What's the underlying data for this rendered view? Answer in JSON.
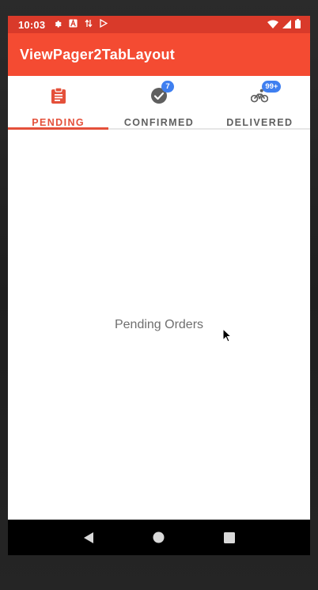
{
  "status_bar": {
    "time": "10:03",
    "bg_color": "#d93a2a"
  },
  "app_bar": {
    "title": "ViewPager2TabLayout",
    "bg_color": "#f44b32"
  },
  "tabs": [
    {
      "label": "PENDING",
      "icon": "clipboard-icon",
      "badge": "",
      "active": true
    },
    {
      "label": "CONFIRMED",
      "icon": "check-circle-icon",
      "badge": "7",
      "active": false
    },
    {
      "label": "DELIVERED",
      "icon": "bicycle-rider-icon",
      "badge": "99+",
      "active": false
    }
  ],
  "colors": {
    "accent": "#e4503a",
    "badge": "#3f7ff0",
    "tab_text": "#5f5f5f"
  },
  "content": {
    "text": "Pending Orders"
  },
  "nav_bar": {
    "buttons": [
      "back-icon",
      "home-icon",
      "recents-icon"
    ]
  }
}
